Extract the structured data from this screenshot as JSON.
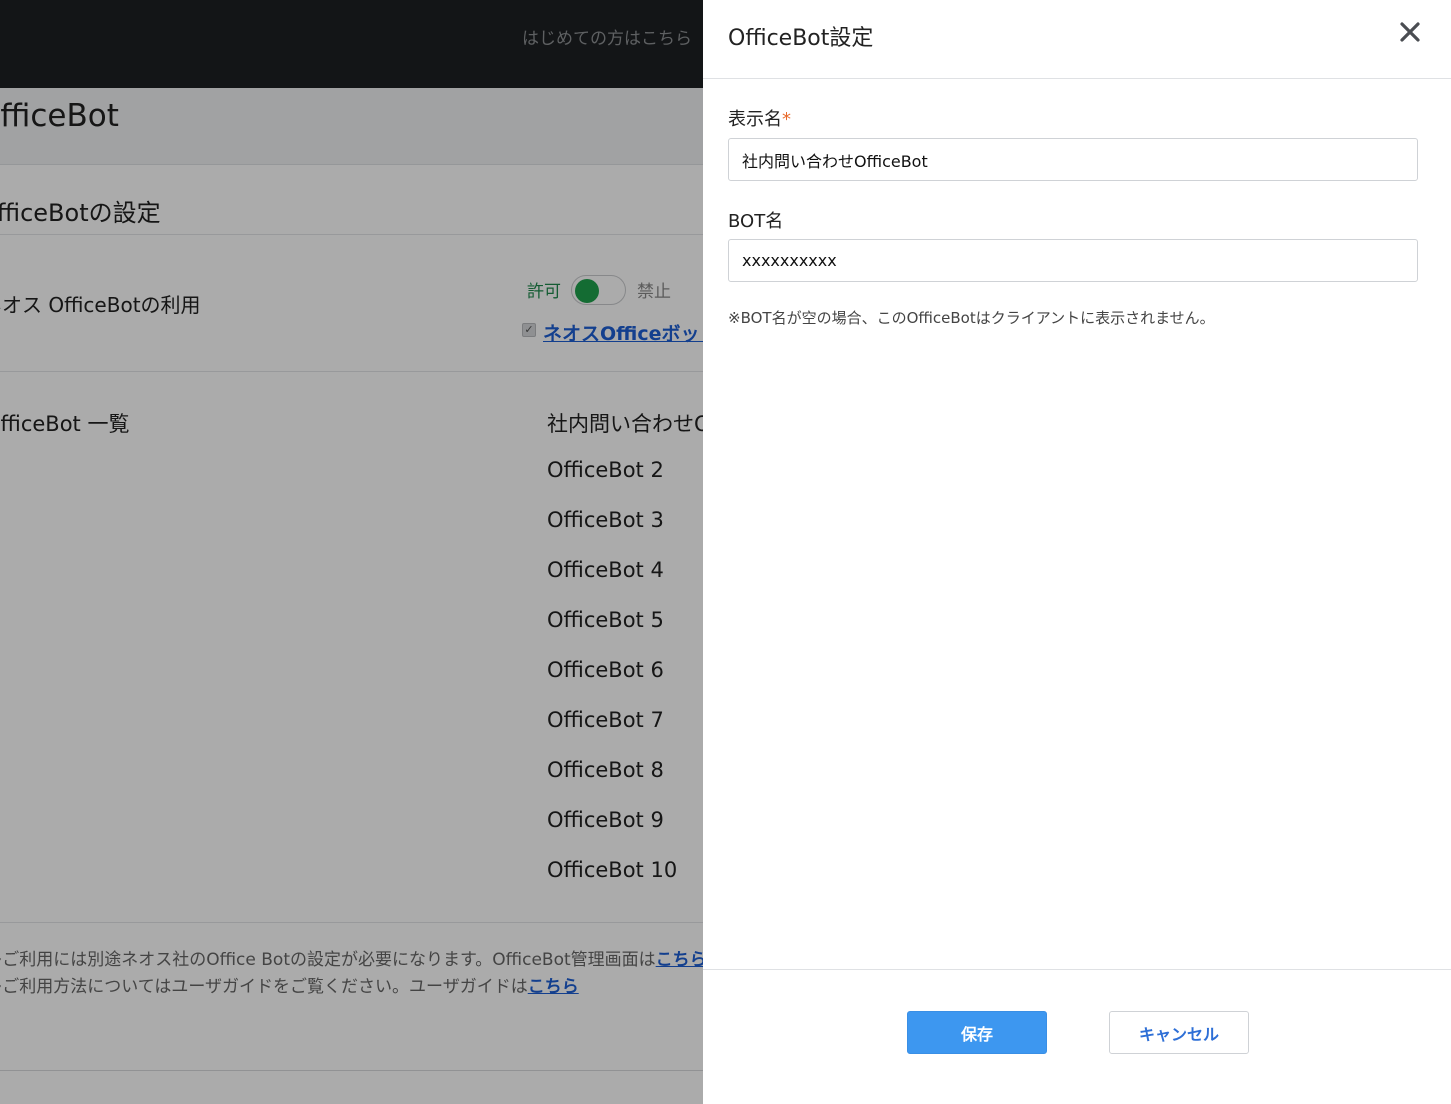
{
  "topbar": {
    "first_time_link": "はじめての方はこちら"
  },
  "page": {
    "title": "OfficeBot",
    "section_title": "OfficeBotの設定",
    "usage_label": "ネオス OfficeBotの利用",
    "toggle": {
      "allow_label": "許可",
      "deny_label": "禁止",
      "state": "on",
      "on_color": "#1ea14d"
    },
    "neos_link": "ネオスOfficeボット",
    "list_label": "OfficeBot 一覧",
    "bots": [
      "社内問い合わせOfficeBot",
      "OfficeBot 2",
      "OfficeBot 3",
      "OfficeBot 4",
      "OfficeBot 5",
      "OfficeBot 6",
      "OfficeBot 7",
      "OfficeBot 8",
      "OfficeBot 9",
      "OfficeBot 10"
    ],
    "footnote_1": "※ご利用には別途ネオス社のOffice Botの設定が必要になります。OfficeBot管理画面は",
    "footnote_1_link": "こちら",
    "footnote_2": "※ご利用方法についてはユーザガイドをご覧ください。ユーザガイドは",
    "footnote_2_link": "こちら"
  },
  "drawer": {
    "title": "OfficeBot設定",
    "display_name": {
      "label": "表示名",
      "required_mark": "*",
      "value": "社内問い合わせOfficeBot"
    },
    "bot_name": {
      "label": "BOT名",
      "value": "xxxxxxxxxx"
    },
    "note": "※BOT名が空の場合、このOfficeBotはクライアントに表示されません。",
    "save_label": "保存",
    "cancel_label": "キャンセル"
  },
  "colors": {
    "topbar": "#1d2023",
    "link": "#1d5fd4",
    "primary_button": "#3d97f0",
    "required": "#e8692a",
    "allow_text": "#1e8a4c"
  },
  "icons": {
    "close": "close-icon",
    "checkbox": "check-icon"
  }
}
